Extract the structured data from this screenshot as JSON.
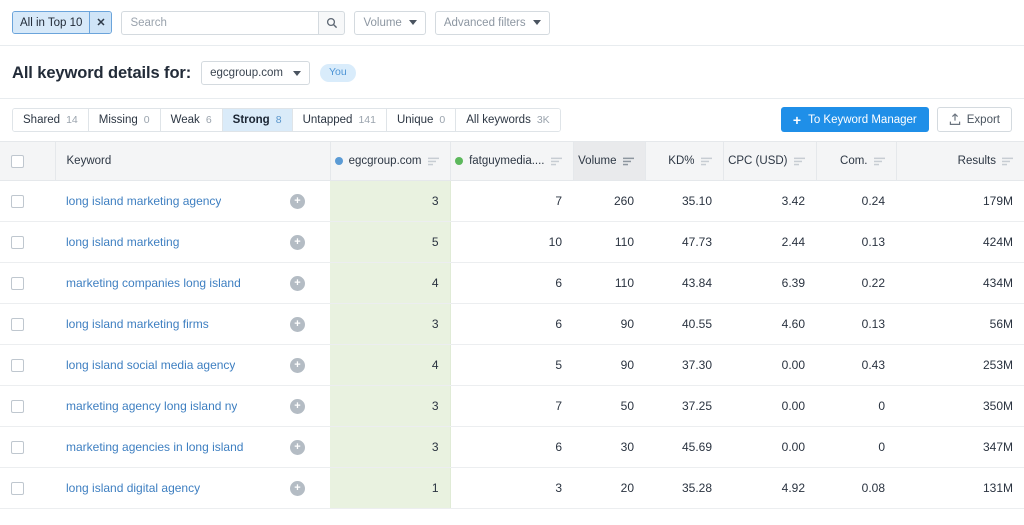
{
  "colors": {
    "accent": "#1f8fe8",
    "chip_bg": "#d7e9f9",
    "own_col_bg": "#e9f2e0",
    "link": "#3e7fc1",
    "dot_own": "#5b9bd5",
    "dot_competitor": "#5cb85c"
  },
  "filter_bar": {
    "active_chip": {
      "label": "All in Top 10",
      "remove_icon": "close-icon"
    },
    "search": {
      "value": "",
      "placeholder": "Search",
      "icon": "search-icon"
    },
    "volume_dropdown": {
      "label": "Volume",
      "icon": "chevron-down-icon"
    },
    "advanced_filters": {
      "label": "Advanced filters",
      "icon": "chevron-down-icon"
    }
  },
  "header": {
    "title": "All keyword details for:",
    "domain": "egcgroup.com",
    "domain_caret": "chevron-down-icon",
    "you_badge": "You"
  },
  "tabs": [
    {
      "label": "Shared",
      "count": "14",
      "active": false
    },
    {
      "label": "Missing",
      "count": "0",
      "active": false
    },
    {
      "label": "Weak",
      "count": "6",
      "active": false
    },
    {
      "label": "Strong",
      "count": "8",
      "active": true
    },
    {
      "label": "Untapped",
      "count": "141",
      "active": false
    },
    {
      "label": "Unique",
      "count": "0",
      "active": false
    },
    {
      "label": "All keywords",
      "count": "3K",
      "active": false
    }
  ],
  "actions": {
    "keyword_manager": {
      "label": "To Keyword Manager",
      "icon": "plus-icon"
    },
    "export": {
      "label": "Export",
      "icon": "export-upload-icon"
    }
  },
  "table": {
    "select_all_checkbox": "checkbox-unchecked",
    "columns": [
      {
        "key": "checkbox",
        "label": "",
        "align": "left",
        "sorted": false
      },
      {
        "key": "keyword",
        "label": "Keyword",
        "align": "left",
        "sorted": false
      },
      {
        "key": "egcgroup",
        "label": "egcgroup.com",
        "align": "right",
        "sorted": false,
        "dot": "#5b9bd5",
        "sort_icon": "sort-icon"
      },
      {
        "key": "fatguymedia",
        "label": "fatguymedia....",
        "align": "right",
        "sorted": false,
        "dot": "#5cb85c",
        "sort_icon": "sort-icon"
      },
      {
        "key": "volume",
        "label": "Volume",
        "align": "right",
        "sorted": true,
        "sort_icon": "sort-icon"
      },
      {
        "key": "kd",
        "label": "KD%",
        "align": "right",
        "sorted": false,
        "sort_icon": "sort-icon"
      },
      {
        "key": "cpc",
        "label": "CPC (USD)",
        "align": "right",
        "sorted": false,
        "sort_icon": "sort-icon"
      },
      {
        "key": "com",
        "label": "Com.",
        "align": "right",
        "sorted": false,
        "sort_icon": "sort-icon"
      },
      {
        "key": "results",
        "label": "Results",
        "align": "right",
        "sorted": false,
        "sort_icon": "sort-icon"
      }
    ],
    "rows": [
      {
        "keyword": "long island marketing agency",
        "add_icon": "plus-circle-icon",
        "egcgroup": "3",
        "fatguymedia": "7",
        "volume": "260",
        "kd": "35.10",
        "cpc": "3.42",
        "com": "0.24",
        "results": "179M"
      },
      {
        "keyword": "long island marketing",
        "add_icon": "plus-circle-icon",
        "egcgroup": "5",
        "fatguymedia": "10",
        "volume": "110",
        "kd": "47.73",
        "cpc": "2.44",
        "com": "0.13",
        "results": "424M"
      },
      {
        "keyword": "marketing companies long island",
        "add_icon": "plus-circle-icon",
        "egcgroup": "4",
        "fatguymedia": "6",
        "volume": "110",
        "kd": "43.84",
        "cpc": "6.39",
        "com": "0.22",
        "results": "434M"
      },
      {
        "keyword": "long island marketing firms",
        "add_icon": "plus-circle-icon",
        "egcgroup": "3",
        "fatguymedia": "6",
        "volume": "90",
        "kd": "40.55",
        "cpc": "4.60",
        "com": "0.13",
        "results": "56M"
      },
      {
        "keyword": "long island social media agency",
        "add_icon": "plus-circle-icon",
        "egcgroup": "4",
        "fatguymedia": "5",
        "volume": "90",
        "kd": "37.30",
        "cpc": "0.00",
        "com": "0.43",
        "results": "253M"
      },
      {
        "keyword": "marketing agency long island ny",
        "add_icon": "plus-circle-icon",
        "egcgroup": "3",
        "fatguymedia": "7",
        "volume": "50",
        "kd": "37.25",
        "cpc": "0.00",
        "com": "0",
        "results": "350M"
      },
      {
        "keyword": "marketing agencies in long island",
        "add_icon": "plus-circle-icon",
        "egcgroup": "3",
        "fatguymedia": "6",
        "volume": "30",
        "kd": "45.69",
        "cpc": "0.00",
        "com": "0",
        "results": "347M"
      },
      {
        "keyword": "long island digital agency",
        "add_icon": "plus-circle-icon",
        "egcgroup": "1",
        "fatguymedia": "3",
        "volume": "20",
        "kd": "35.28",
        "cpc": "4.92",
        "com": "0.08",
        "results": "131M"
      }
    ]
  }
}
